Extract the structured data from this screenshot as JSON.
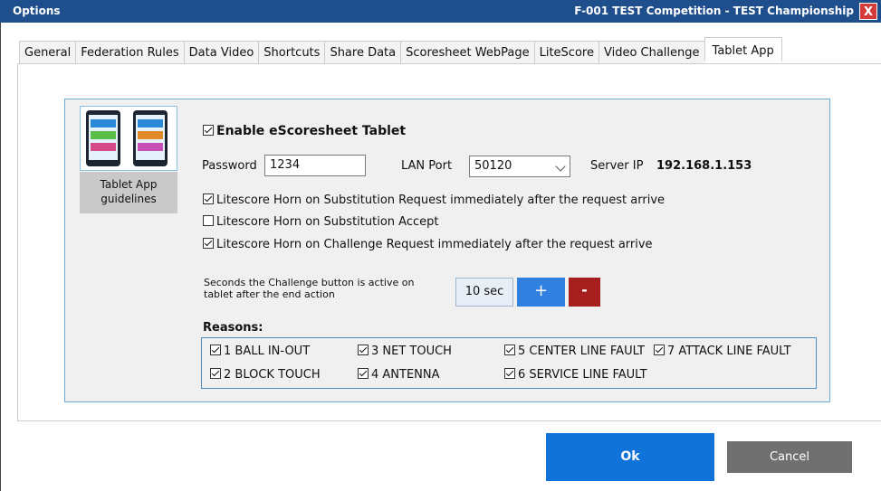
{
  "window": {
    "title": "Options",
    "context_title": "F-001  TEST Competition - TEST Championship",
    "close_label": "X"
  },
  "tabs": [
    {
      "label": "General"
    },
    {
      "label": "Federation Rules"
    },
    {
      "label": "Data Video"
    },
    {
      "label": "Shortcuts"
    },
    {
      "label": "Share Data"
    },
    {
      "label": "Scoresheet WebPage"
    },
    {
      "label": "LiteScore"
    },
    {
      "label": "Video Challenge"
    },
    {
      "label": "Tablet App",
      "active": true
    }
  ],
  "tablet": {
    "guidelines_label": "Tablet App\nguidelines",
    "enable_label": "Enable eScoresheet Tablet",
    "enable_checked": true,
    "password_label": "Password",
    "password_value": "1234",
    "lan_port_label": "LAN Port",
    "lan_port_value": "50120",
    "server_ip_label": "Server IP",
    "server_ip_value": "192.168.1.153",
    "options": [
      {
        "label": "Litescore Horn on Substitution Request immediately after the request arrive",
        "checked": true
      },
      {
        "label": "Litescore Horn on Substitution Accept",
        "checked": false
      },
      {
        "label": "Litescore Horn on Challenge Request immediately after the request arrive",
        "checked": true
      }
    ],
    "challenge_seconds_label": "Seconds the Challenge button is active on\ntablet after the end action",
    "challenge_seconds_value": "10 sec",
    "plus_label": "+",
    "minus_label": "-",
    "reasons_label": "Reasons:",
    "reasons": [
      {
        "label": "1 BALL IN-OUT",
        "checked": true
      },
      {
        "label": "3 NET TOUCH",
        "checked": true
      },
      {
        "label": "5 CENTER LINE FAULT",
        "checked": true
      },
      {
        "label": "7 ATTACK LINE FAULT",
        "checked": true
      },
      {
        "label": "2 BLOCK TOUCH",
        "checked": true
      },
      {
        "label": "4 ANTENNA",
        "checked": true
      },
      {
        "label": "6 SERVICE LINE FAULT",
        "checked": true
      }
    ]
  },
  "footer": {
    "ok_label": "Ok",
    "cancel_label": "Cancel"
  },
  "colors": {
    "titlebar": "#1f4e8c",
    "close": "#d63a3a",
    "ok": "#0f73d9",
    "plus": "#2f80e0",
    "minus": "#a61e1e",
    "cancel": "#707070"
  }
}
